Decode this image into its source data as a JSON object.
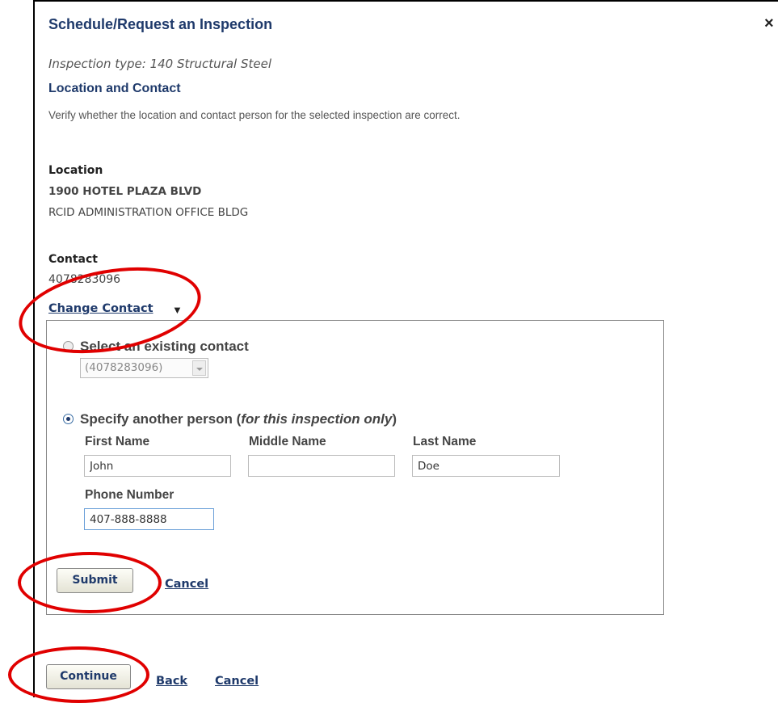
{
  "dialog": {
    "title": "Schedule/Request an Inspection",
    "close_label": "×",
    "inspection_type": "Inspection type: 140 Structural Steel",
    "section_title": "Location and Contact",
    "description": "Verify whether the location and contact person for the selected inspection are correct."
  },
  "location": {
    "label": "Location",
    "address": "1900 HOTEL PLAZA BLVD",
    "name": "RCID ADMINISTRATION OFFICE BLDG"
  },
  "contact": {
    "label": "Contact",
    "phone": "4078283096",
    "change_link": "Change Contact",
    "change_caret": "▼"
  },
  "change_panel": {
    "existing_option": "Select an existing contact",
    "existing_value": "(4078283096)",
    "other_option_prefix": "Specify another person (",
    "other_option_em": "for this inspection only",
    "other_option_suffix": ")",
    "first_name_label": "First Name",
    "middle_name_label": "Middle Name",
    "last_name_label": "Last Name",
    "first_name_value": "John",
    "middle_name_value": "",
    "last_name_value": "Doe",
    "phone_label": "Phone Number",
    "phone_value": "407-888-8888",
    "submit_label": "Submit",
    "cancel_label": "Cancel",
    "selected_option": "other"
  },
  "footer": {
    "continue_label": "Continue",
    "back_label": "Back",
    "cancel_label": "Cancel"
  },
  "colors": {
    "heading": "#1f3a6b",
    "annotation": "#e00000"
  }
}
